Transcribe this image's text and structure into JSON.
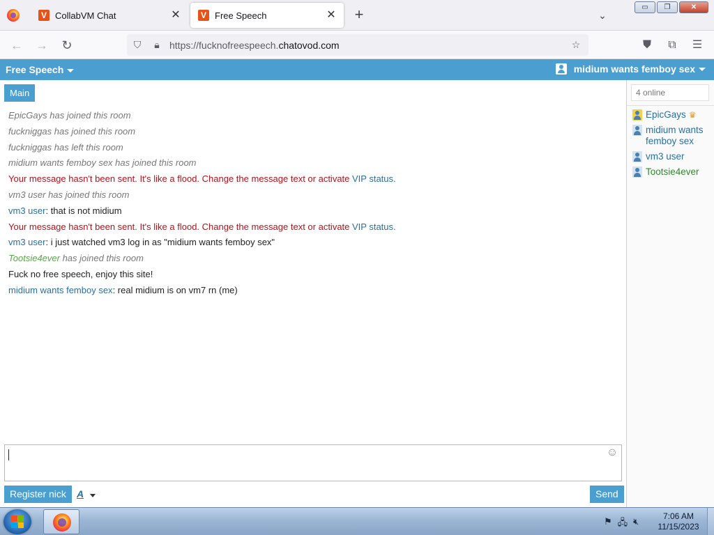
{
  "browser": {
    "tabs": [
      {
        "title": "CollabVM Chat",
        "active": false
      },
      {
        "title": "Free Speech",
        "active": true
      }
    ],
    "url_prefix": "https://fucknofreespeech.",
    "url_host": "chatovod.com",
    "window_controls": {
      "minimize": "▭",
      "maximize": "❐",
      "close": "✕"
    }
  },
  "chat": {
    "room_title": "Free Speech",
    "current_user": "midium wants femboy sex",
    "room_tab": "Main",
    "messages": [
      {
        "type": "system",
        "text": "EpicGays has joined this room"
      },
      {
        "type": "system",
        "text": "fuckniggas has joined this room"
      },
      {
        "type": "system",
        "text": "fuckniggas has left this room"
      },
      {
        "type": "system",
        "text": "midium wants femboy sex has joined this room"
      },
      {
        "type": "error",
        "text": "Your message hasn't been sent. It's like a flood. Change the message text or activate ",
        "link": "VIP status."
      },
      {
        "type": "system",
        "text": "vm3 user has joined this room"
      },
      {
        "type": "user",
        "nick": "vm3 user",
        "text": ": that is not midium"
      },
      {
        "type": "error",
        "text": "Your message hasn't been sent. It's like a flood. Change the message text or activate ",
        "link": "VIP status."
      },
      {
        "type": "user",
        "nick": "vm3 user",
        "text": ": i just watched vm3 log in as \"midium wants femboy sex\""
      },
      {
        "type": "system-nick",
        "nick": "Tootsie4ever",
        "text": " has joined this room"
      },
      {
        "type": "plain",
        "text": "Fuck no free speech, enjoy this site!"
      },
      {
        "type": "user",
        "nick": "midium wants femboy sex",
        "text": ": real midium is on vm7 rn (me)"
      }
    ],
    "register_label": "Register nick",
    "font_label": "A",
    "send_label": "Send",
    "online_count": "4 online",
    "users": [
      {
        "name": "EpicGays",
        "owner": true,
        "color": "#2a6fa0"
      },
      {
        "name": "midium wants femboy sex",
        "owner": false,
        "color": "#2a6fa0"
      },
      {
        "name": "vm3 user",
        "owner": false,
        "color": "#2a6fa0"
      },
      {
        "name": "Tootsie4ever",
        "owner": false,
        "color": "#2f8a2f"
      }
    ]
  },
  "taskbar": {
    "time": "7:06 AM",
    "date": "11/15/2023"
  },
  "colors": {
    "accent": "#4a9fd0",
    "error": "#b5121b",
    "nick": "#2a6fa0"
  }
}
